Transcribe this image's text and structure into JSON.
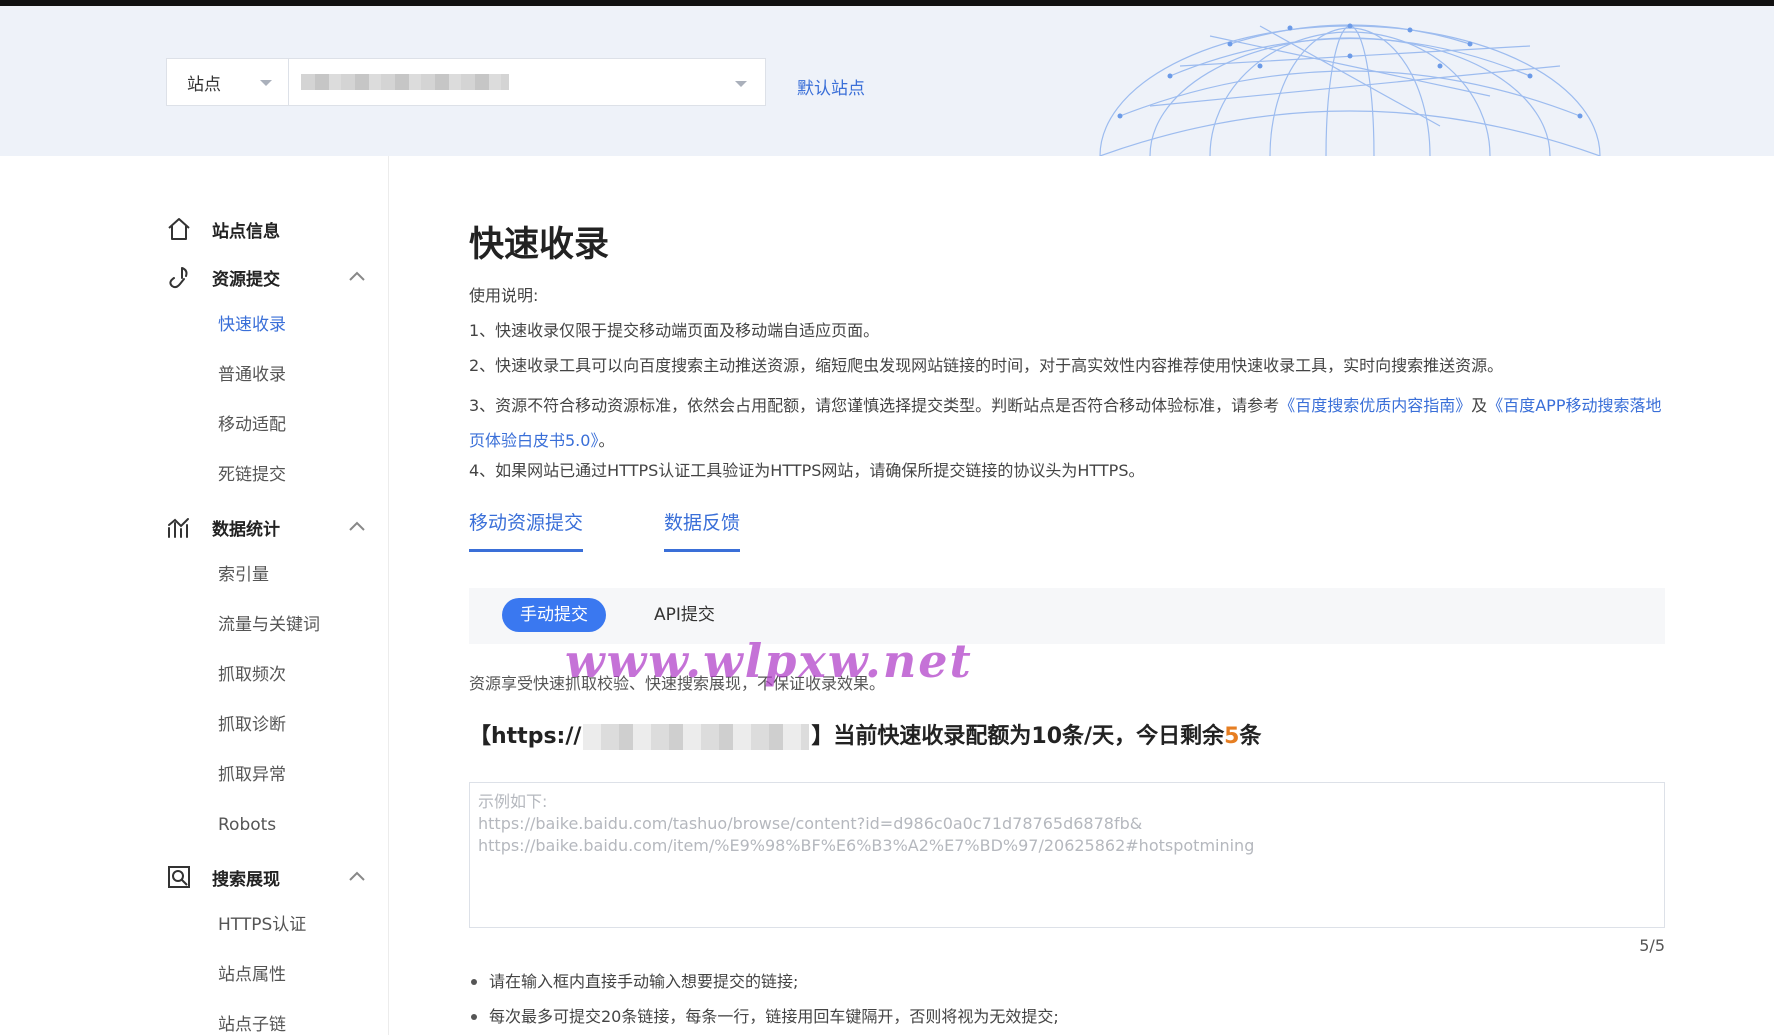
{
  "header": {
    "site_type_label": "站点",
    "default_site_link": "默认站点"
  },
  "sidebar": {
    "groups": [
      {
        "label": "站点信息",
        "icon": "home-icon",
        "items": []
      },
      {
        "label": "资源提交",
        "icon": "submit-link-icon",
        "items": [
          "快速收录",
          "普通收录",
          "移动适配",
          "死链提交"
        ]
      },
      {
        "label": "数据统计",
        "icon": "stats-chart-icon",
        "items": [
          "索引量",
          "流量与关键词",
          "抓取频次",
          "抓取诊断",
          "抓取异常",
          "Robots"
        ]
      },
      {
        "label": "搜索展现",
        "icon": "search-display-icon",
        "items": [
          "HTTPS认证",
          "站点属性",
          "站点子链"
        ]
      }
    ],
    "active_item": "快速收录"
  },
  "main": {
    "title": "快速收录",
    "instructions_heading": "使用说明:",
    "instruction_1": "1、快速收录仅限于提交移动端页面及移动端自适应页面。",
    "instruction_2": "2、快速收录工具可以向百度搜索主动推送资源，缩短爬虫发现网站链接的时间，对于高实效性内容推荐使用快速收录工具，实时向搜索推送资源。",
    "instruction_3_prefix": "3、资源不符合移动资源标准，依然会占用配额，请您谨慎选择提交类型。判断站点是否符合移动体验标准，请参考",
    "instruction_3_link1": "《百度搜索优质内容指南》",
    "instruction_3_mid": "及",
    "instruction_3_link2": "《百度APP移动搜索落地页体验白皮书5.0》",
    "instruction_3_suffix": "。",
    "instruction_4": "4、如果网站已通过HTTPS认证工具验证为HTTPS网站，请确保所提交链接的协议头为HTTPS。",
    "tabs": [
      "移动资源提交",
      "数据反馈"
    ],
    "subtabs": [
      "手动提交",
      "API提交"
    ],
    "description": "资源享受快速抓取校验、快速搜索展现，不保证收录效果。",
    "watermark": "www.wlpxw.net",
    "quota_prefix": "【https://",
    "quota_middle": "】当前快速收录配额为10条/天，今日剩余",
    "quota_remaining": "5",
    "quota_suffix": "条",
    "textarea_placeholder_lines": [
      "示例如下:",
      "https://baike.baidu.com/tashuo/browse/content?id=d986c0a0c71d78765d6878fb&",
      "https://baike.baidu.com/item/%E9%98%BF%E6%B3%A2%E7%BD%97/20625862#hotspotmining"
    ],
    "counter": "5/5",
    "bullets": [
      "请在输入框内直接手动输入想要提交的链接;",
      "每次最多可提交20条链接，每条一行，链接用回车键隔开，否则将视为无效提交;"
    ]
  },
  "colors": {
    "accent": "#3a6fd8",
    "pill": "#3a78f0",
    "remaining": "#e67e22",
    "header_bg": "#eef2f9"
  }
}
